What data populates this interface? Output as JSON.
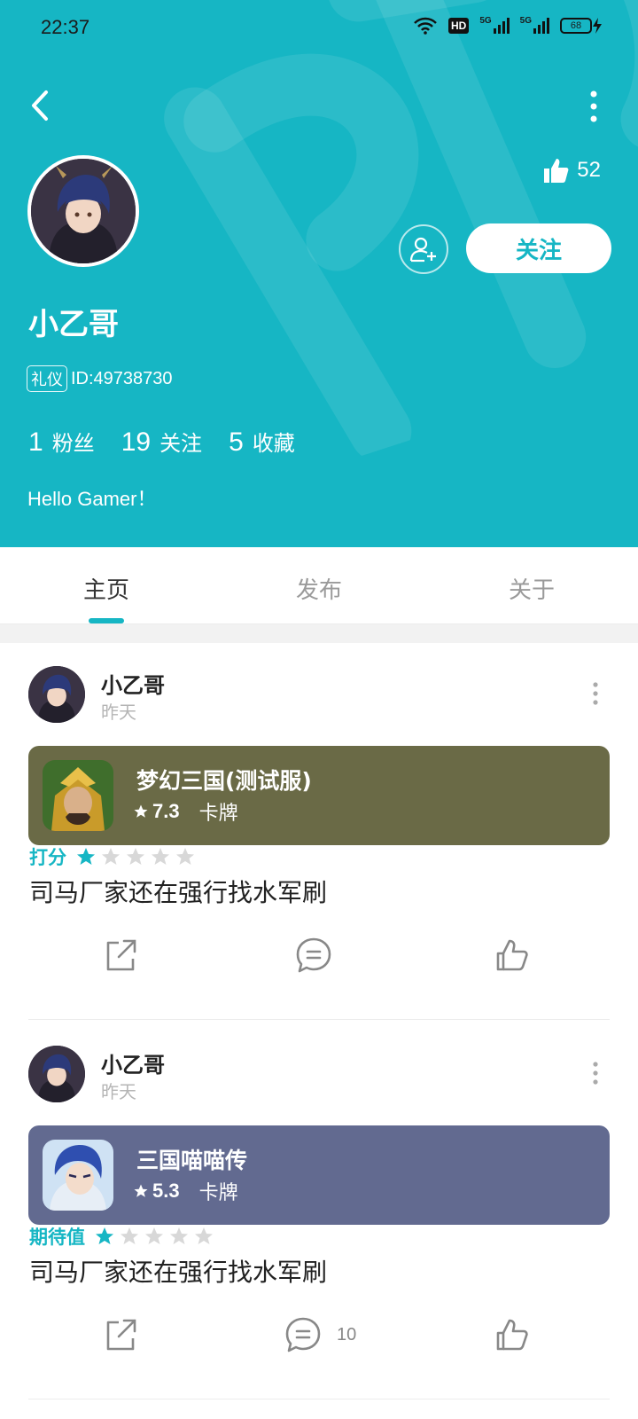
{
  "status_bar": {
    "time": "22:37",
    "network_label": "5G",
    "hd_label": "HD",
    "battery": "68"
  },
  "profile": {
    "likes": "52",
    "follow_label": "关注",
    "name": "小乙哥",
    "badge": "礼仪",
    "id_text": "ID:49738730",
    "stats": [
      {
        "num": "1",
        "label": "粉丝"
      },
      {
        "num": "19",
        "label": "关注"
      },
      {
        "num": "5",
        "label": "收藏"
      }
    ],
    "bio": "Hello Gamer！"
  },
  "tabs": [
    {
      "label": "主页",
      "active": true
    },
    {
      "label": "发布",
      "active": false
    },
    {
      "label": "关于",
      "active": false
    }
  ],
  "posts": [
    {
      "author": "小乙哥",
      "time": "昨天",
      "game": {
        "title": "梦幻三国(测试服)",
        "score": "7.3",
        "genre": "卡牌",
        "card_color": "#6a6a46"
      },
      "rating_label": "打分",
      "rating": 1,
      "rating_max": 5,
      "text": "司马厂家还在强行找水军刷",
      "comment_count": ""
    },
    {
      "author": "小乙哥",
      "time": "昨天",
      "game": {
        "title": "三国喵喵传",
        "score": "5.3",
        "genre": "卡牌",
        "card_color": "#626a90"
      },
      "rating_label": "期待值",
      "rating": 1,
      "rating_max": 5,
      "text": "司马厂家还在强行找水军刷",
      "comment_count": "10"
    }
  ],
  "colors": {
    "accent": "#16b6c4",
    "star_empty": "#d8d8d8"
  },
  "icons": [
    "back-arrow-icon",
    "more-vertical-icon",
    "thumbs-up-icon",
    "add-friend-icon",
    "share-icon",
    "comment-icon",
    "like-icon",
    "star-icon"
  ]
}
